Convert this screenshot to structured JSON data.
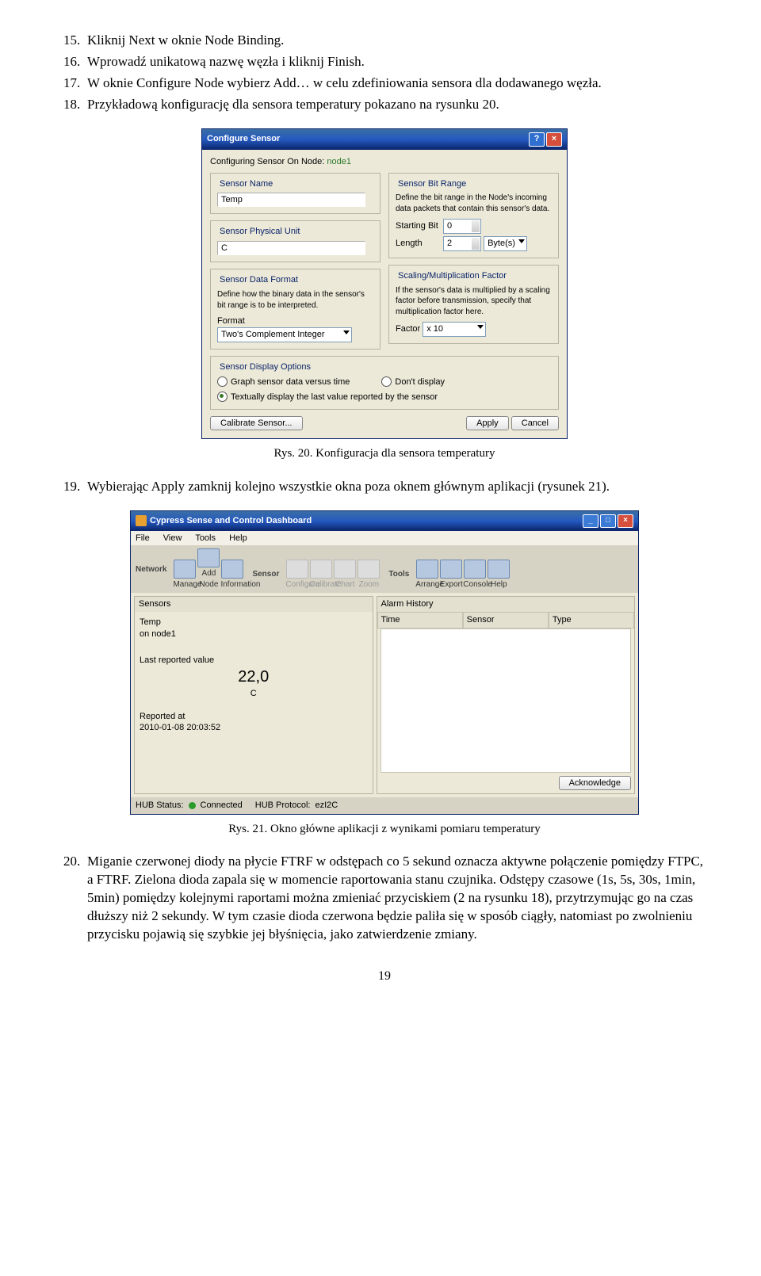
{
  "list": {
    "i15": {
      "num": "15.",
      "txt": "Kliknij Next w oknie Node Binding."
    },
    "i16": {
      "num": "16.",
      "txt": "Wprowadź unikatową nazwę węzła i kliknij Finish."
    },
    "i17": {
      "num": "17.",
      "txt": "W oknie Configure Node wybierz Add… w celu zdefiniowania sensora dla dodawanego węzła."
    },
    "i18": {
      "num": "18.",
      "txt": "Przykładową konfigurację dla sensora temperatury pokazano na rysunku 20."
    },
    "i19": {
      "num": "19.",
      "txt": "Wybierając Apply zamknij kolejno wszystkie okna poza oknem głównym aplikacji (rysunek 21)."
    },
    "i20": {
      "num": "20.",
      "txt": "Miganie czerwonej diody na płycie FTRF w odstępach co 5 sekund oznacza aktywne połączenie pomiędzy FTPC, a FTRF. Zielona dioda zapala się w momencie raportowania stanu czujnika. Odstępy czasowe (1s, 5s, 30s, 1min, 5min) pomiędzy kolejnymi raportami można zmieniać przyciskiem (2 na rysunku 18), przytrzymując go na czas dłuższy niż 2 sekundy. W tym czasie dioda czerwona będzie paliła się w sposób ciągły, natomiast po zwolnieniu przycisku pojawią się szybkie jej błyśnięcia, jako zatwierdzenie zmiany."
    }
  },
  "caption1": "Rys. 20. Konfiguracja dla sensora temperatury",
  "caption2": "Rys. 21. Okno główne aplikacji z wynikami pomiaru temperatury",
  "pageNum": "19",
  "dlg1": {
    "title": "Configure Sensor",
    "cfgOn": "Configuring Sensor On Node:",
    "node": "node1",
    "sensorName": "Sensor Name",
    "nameVal": "Temp",
    "bitRange": "Sensor Bit Range",
    "bitRangeDesc": "Define the bit range in the Node's incoming data packets that contain this sensor's data.",
    "startBit": "Starting Bit",
    "startBitVal": "0",
    "length": "Length",
    "lengthVal": "2",
    "bytes": "Byte(s)",
    "physUnit": "Sensor Physical Unit",
    "unitVal": "C",
    "dataFmt": "Sensor Data Format",
    "dataFmtDesc": "Define how the binary data in the sensor's bit range is to be interpreted.",
    "format": "Format",
    "formatVal": "Two's Complement Integer",
    "scaling": "Scaling/Multiplication Factor",
    "scalingDesc": "If the sensor's data is multiplied by a scaling factor before transmission, specify that multiplication factor here.",
    "factor": "Factor",
    "factorVal": "x 10",
    "dispOpt": "Sensor Display Options",
    "opt1": "Graph sensor data versus time",
    "opt2": "Don't display",
    "opt3": "Textually display the last value reported by the sensor",
    "calib": "Calibrate Sensor...",
    "apply": "Apply",
    "cancel": "Cancel"
  },
  "dlg2": {
    "title": "Cypress Sense and Control Dashboard",
    "menu": {
      "file": "File",
      "view": "View",
      "tools": "Tools",
      "help": "Help"
    },
    "tb": {
      "network": "Network",
      "manage": "Manage",
      "addnode": "Add Node",
      "info": "Information",
      "sensor": "Sensor",
      "configure": "Configure",
      "calibrate": "Calibrate",
      "chart": "Chart",
      "zoom": "Zoom",
      "tools": "Tools",
      "arrange": "Arrange",
      "export": "Export",
      "console": "Console",
      "help": "Help"
    },
    "sensorsH": "Sensors",
    "temp": "Temp",
    "onnode": "on node1",
    "lastRep": "Last reported value",
    "value": "22,0",
    "unit": "C",
    "repAt": "Reported at",
    "ts": "2010-01-08 20:03:52",
    "alarmH": "Alarm History",
    "time": "Time",
    "sensorCol": "Sensor",
    "type": "Type",
    "ack": "Acknowledge",
    "hubStatus": "HUB Status:",
    "connected": "Connected",
    "hubProto": "HUB Protocol:",
    "proto": "ezI2C"
  }
}
